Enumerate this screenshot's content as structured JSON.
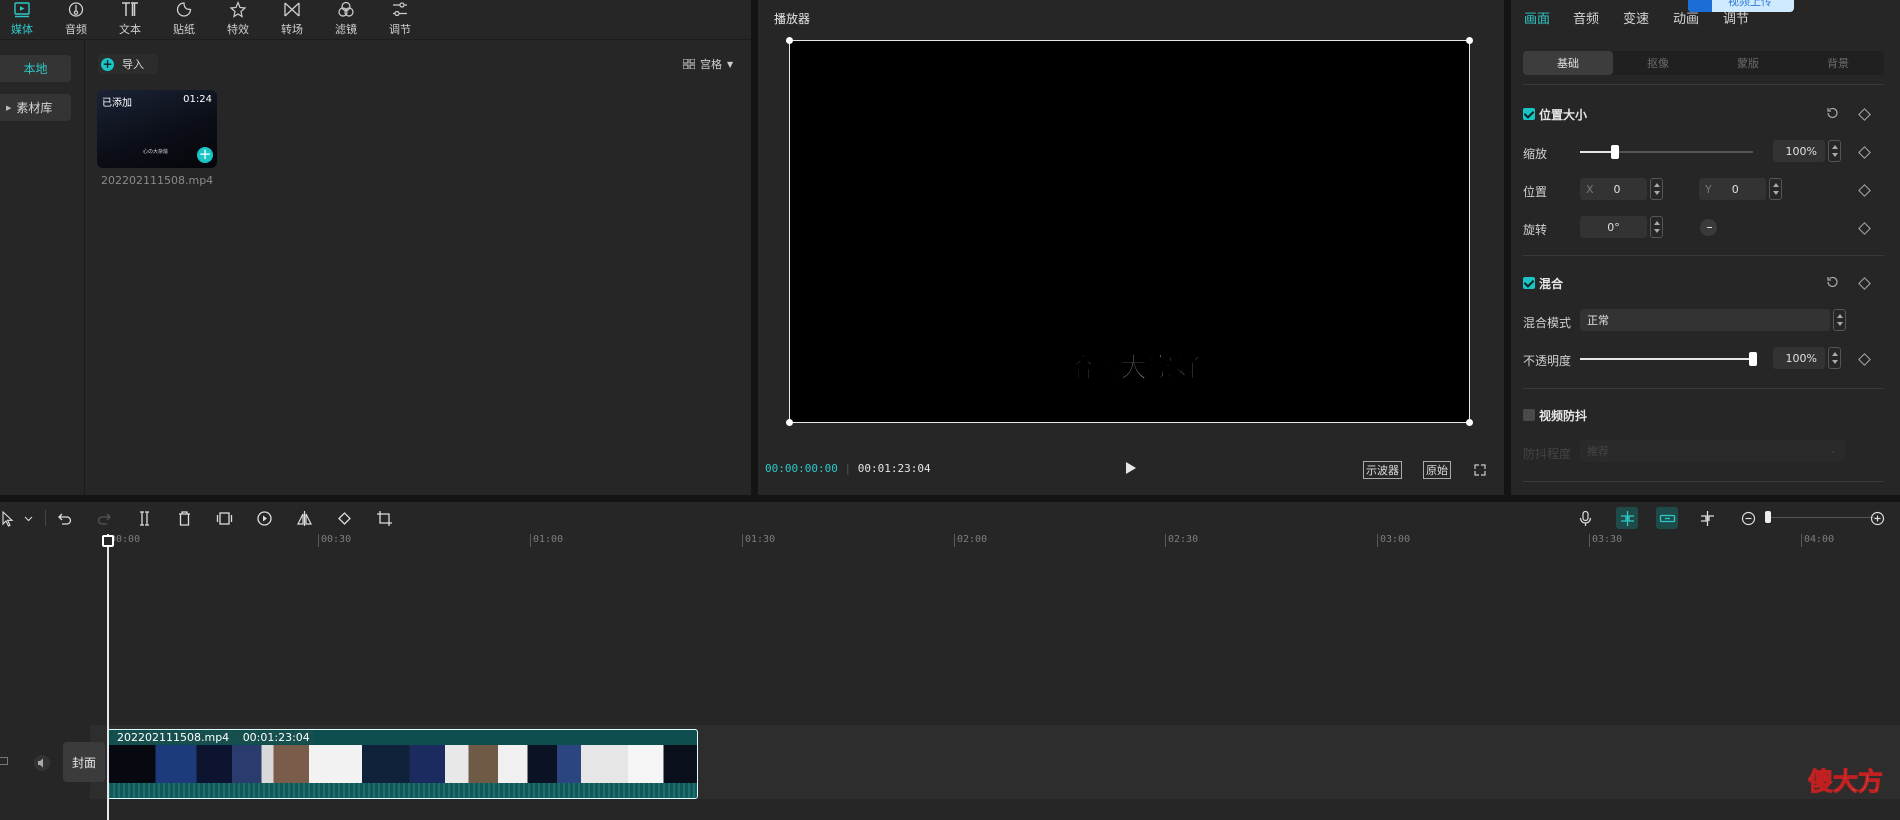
{
  "top_tabs": [
    {
      "label": "媒体",
      "icon": "media-icon",
      "active": true
    },
    {
      "label": "音频",
      "icon": "audio-icon"
    },
    {
      "label": "文本",
      "icon": "text-icon"
    },
    {
      "label": "贴纸",
      "icon": "sticker-icon"
    },
    {
      "label": "特效",
      "icon": "effects-icon"
    },
    {
      "label": "转场",
      "icon": "transition-icon"
    },
    {
      "label": "滤镜",
      "icon": "filter-icon"
    },
    {
      "label": "调节",
      "icon": "adjust-icon"
    }
  ],
  "side_nav": {
    "local": "本地",
    "library": "素材库"
  },
  "media": {
    "import_label": "导入",
    "view_mode": "宫格",
    "item": {
      "badge": "已添加",
      "duration": "01:24",
      "thumb_caption": "心の大杂烩",
      "filename": "202202111508.mp4"
    }
  },
  "player": {
    "title": "播放器",
    "subtitle": "哈喽大家好",
    "current_time": "00:00:00:00",
    "total_time": "00:01:23:04",
    "btn_scope": "示波器",
    "btn_original": "原始"
  },
  "props": {
    "upload_badge": "视频上传",
    "tabs": [
      "画面",
      "音频",
      "变速",
      "动画",
      "调节"
    ],
    "active_tab": "画面",
    "sub_tabs": [
      "基础",
      "抠像",
      "蒙版",
      "背景"
    ],
    "position_size": {
      "title": "位置大小",
      "scale_label": "缩放",
      "scale_value": "100%",
      "scale_fraction": 0.2,
      "position_label": "位置",
      "x_label": "X",
      "x_value": "0",
      "y_label": "Y",
      "y_value": "0",
      "rotate_label": "旋转",
      "rotate_value": "0°"
    },
    "blend": {
      "title": "混合",
      "mode_label": "混合模式",
      "mode_value": "正常",
      "opacity_label": "不透明度",
      "opacity_value": "100%",
      "opacity_fraction": 1.0
    },
    "stabilize": {
      "title": "视频防抖",
      "level_label": "防抖程度",
      "level_value": "推荐"
    }
  },
  "timeline": {
    "ruler": [
      "00:00",
      "00:30",
      "01:00",
      "01:30",
      "02:00",
      "02:30",
      "03:00",
      "03:30",
      "04:00"
    ],
    "clip_name": "202202111508.mp4",
    "clip_duration": "00:01:23:04",
    "cover_label": "封面"
  },
  "watermark": "傻大方",
  "colors": {
    "accent": "#19c5c5",
    "panel": "#262626",
    "bg": "#141414"
  }
}
